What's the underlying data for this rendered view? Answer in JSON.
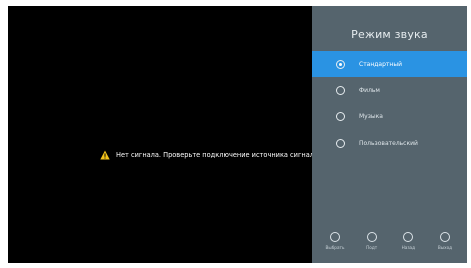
{
  "no_signal": {
    "text": "Нет сигнала. Проверьте подключение источника сигнала."
  },
  "sound_mode_panel": {
    "title": "Режим звука",
    "options": [
      {
        "label": "Стандартный",
        "selected": true
      },
      {
        "label": "Фильм",
        "selected": false
      },
      {
        "label": "Музыка",
        "selected": false
      },
      {
        "label": "Пользовательский",
        "selected": false
      }
    ]
  },
  "footer": {
    "select": "Выбрать",
    "move": "Подт",
    "back": "Назад",
    "exit": "Выход"
  },
  "colors": {
    "screen_bg": "#000000",
    "panel_bg": "#55646d",
    "selected_bg": "#2a93e3",
    "warning": "#f2c21a"
  },
  "icons": {
    "warning": "warning-triangle-icon",
    "select": "ok-icon",
    "move": "up-down-icon",
    "back": "back-icon",
    "exit": "exit-icon"
  }
}
